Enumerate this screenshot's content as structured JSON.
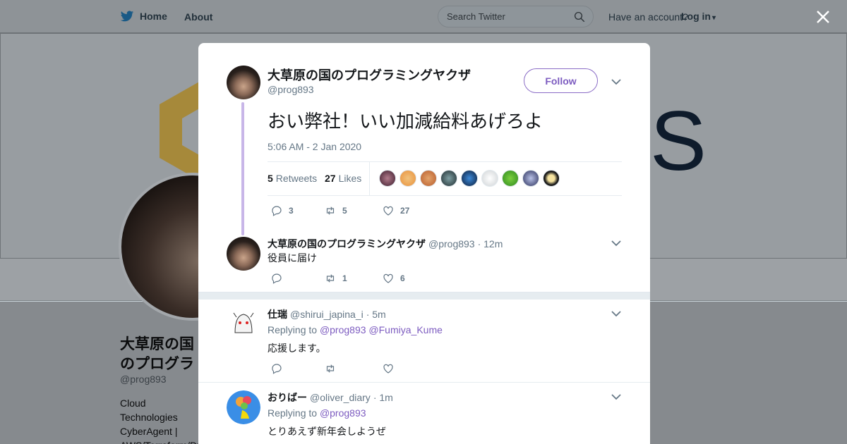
{
  "nav": {
    "home_label": "Home",
    "about_label": "About",
    "search_placeholder": "Search Twitter",
    "have_account": "Have an account?",
    "login_label": "Log in",
    "close_label": "✕"
  },
  "profile_bg": {
    "name": "大草原の国のプログラミングヤクザ",
    "handle": "@prog893",
    "bio": "Cloud Technologies CyberAgent | AWS/Terraform/Dy Mark IV | opinions",
    "banner_text": "S"
  },
  "tweet": {
    "author_name": "大草原の国のプログラミングヤクザ",
    "author_handle": "@prog893",
    "follow_label": "Follow",
    "text": "おい弊社！いい加減給料あげろよ",
    "timestamp": "5:06 AM - 2 Jan 2020",
    "retweets_count": "5",
    "retweets_label": "Retweets",
    "likes_count": "27",
    "likes_label": "Likes",
    "actions": {
      "replies": "3",
      "retweets": "5",
      "likes": "27"
    }
  },
  "replies": [
    {
      "name": "大草原の国のプログラミングヤクザ",
      "handle": "@prog893",
      "time": "· 12m",
      "text": "役員に届け",
      "actions": {
        "replies": "",
        "retweets": "1",
        "likes": "6"
      }
    },
    {
      "name": "仕瑞",
      "handle": "@shirui_japina_i",
      "time": "· 5m",
      "replying_prefix": "Replying to",
      "mentions": [
        "@prog893",
        "@Fumiya_Kume"
      ],
      "text": "応援します。",
      "actions": {
        "replies": "",
        "retweets": "",
        "likes": ""
      }
    },
    {
      "name": "おりばー",
      "handle": "@oliver_diary",
      "time": "· 1m",
      "replying_prefix": "Replying to",
      "mentions": [
        "@prog893"
      ],
      "text": "とりあえず新年会しようぜ"
    }
  ],
  "colors": {
    "accent": "#7d5cc0",
    "thread_line": "#c8b6e8",
    "muted_text": "#657786",
    "divider": "#e6ecf0"
  },
  "icons": [
    "twitter-bird-icon",
    "search-icon",
    "close-icon",
    "chevron-down-icon",
    "reply-icon",
    "retweet-icon",
    "like-icon",
    "caret-down-icon"
  ]
}
